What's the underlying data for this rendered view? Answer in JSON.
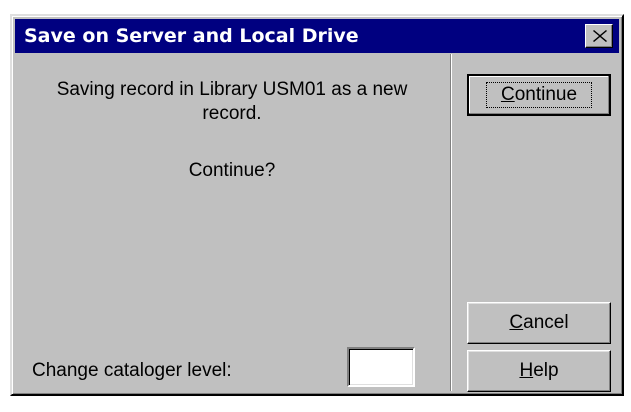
{
  "dialog": {
    "title": "Save on Server and Local Drive",
    "message": "Saving record in Library USM01 as a new record.",
    "question": "Continue?",
    "level_label": "Change cataloger level:",
    "level_value": ""
  },
  "buttons": {
    "continue": {
      "mnemonic": "C",
      "rest": "ontinue"
    },
    "cancel": {
      "mnemonic": "C",
      "rest": "ancel"
    },
    "help": {
      "mnemonic": "H",
      "rest": "elp"
    }
  },
  "icons": {
    "close": "close-icon"
  },
  "colors": {
    "titlebar": "#000080",
    "face": "#c0c0c0"
  }
}
